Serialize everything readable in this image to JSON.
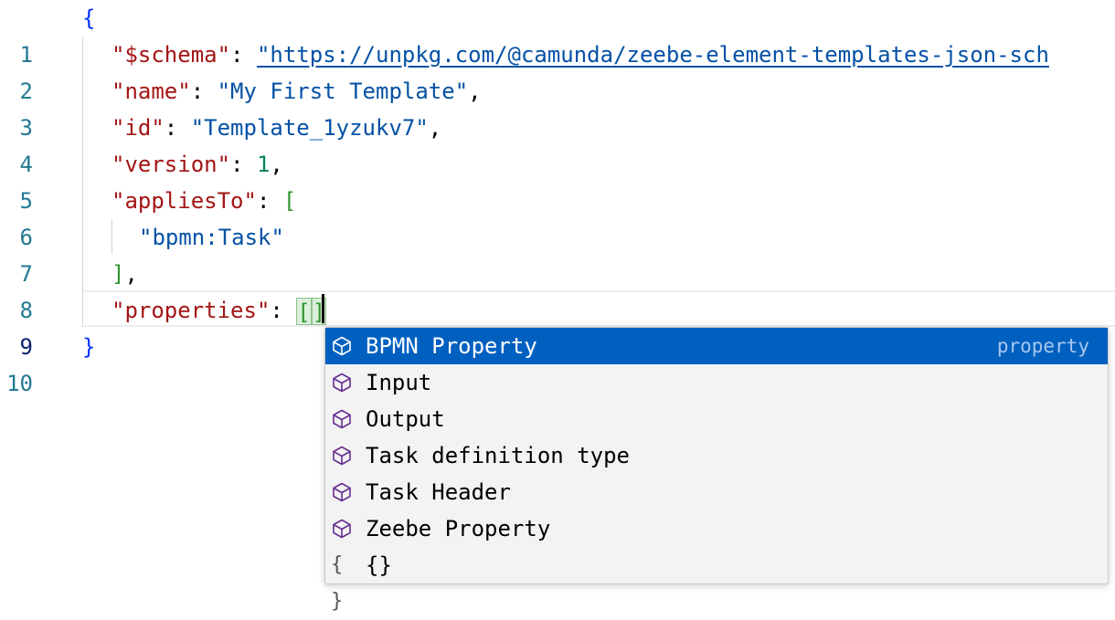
{
  "editor": {
    "line_numbers": [
      "1",
      "2",
      "3",
      "4",
      "5",
      "6",
      "7",
      "8",
      "9",
      "10"
    ],
    "active_line": "9",
    "tokens": {
      "open_brace": "{",
      "close_brace": "}",
      "schema_key": "\"$schema\"",
      "schema_value": "\"https://unpkg.com/@camunda/zeebe-element-templates-json-sch",
      "name_key": "\"name\"",
      "name_value": "\"My First Template\"",
      "id_key": "\"id\"",
      "id_value": "\"Template_1yzukv7\"",
      "version_key": "\"version\"",
      "version_value": "1",
      "applies_key": "\"appliesTo\"",
      "open_bracket": "[",
      "applies_item": "\"bpmn:Task\"",
      "close_bracket": "]",
      "properties_key": "\"properties\"",
      "properties_open": "[",
      "properties_close": "]",
      "colon": ": ",
      "comma": ","
    }
  },
  "suggestions": {
    "items": [
      {
        "label": "BPMN Property",
        "detail": "property",
        "icon": "cube-icon"
      },
      {
        "label": "Input",
        "icon": "cube-icon"
      },
      {
        "label": "Output",
        "icon": "cube-icon"
      },
      {
        "label": "Task definition type",
        "icon": "cube-icon"
      },
      {
        "label": "Task Header",
        "icon": "cube-icon"
      },
      {
        "label": "Zeebe Property",
        "icon": "cube-icon"
      },
      {
        "label": "{}",
        "icon": "braces-icon",
        "icon_glyph": "{ }"
      }
    ]
  },
  "colors": {
    "key": "#a31515",
    "string": "#0451a5",
    "number": "#098658",
    "selection": "#0060c0",
    "icon": "#652d90"
  }
}
